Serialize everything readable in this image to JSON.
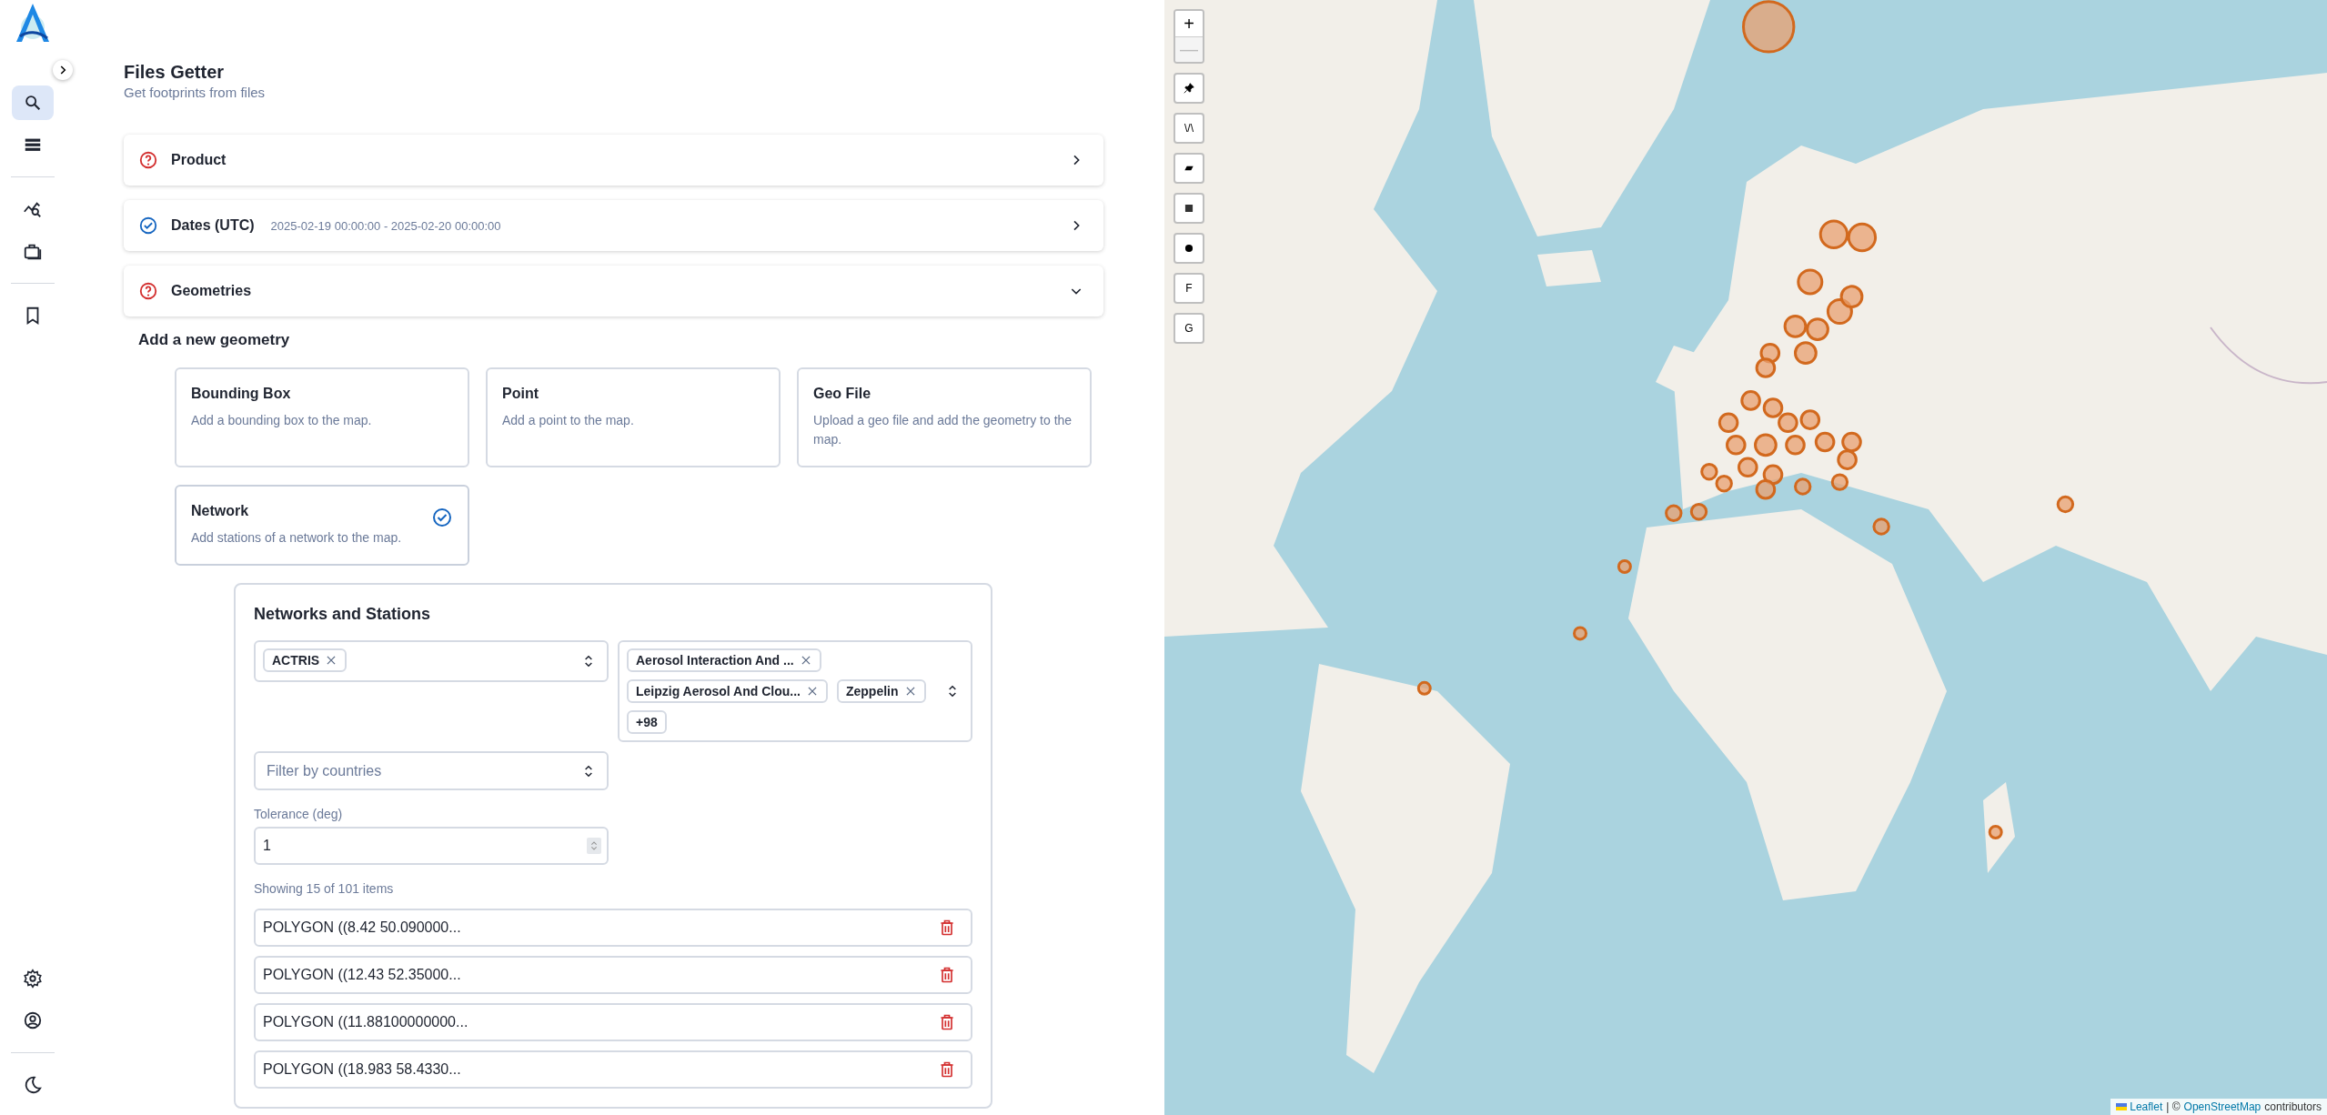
{
  "sidebar": {
    "items": [
      {
        "kind": "search",
        "selected": true
      },
      {
        "kind": "list",
        "selected": false
      },
      {
        "kind": "divider"
      },
      {
        "kind": "chart-search",
        "selected": false
      },
      {
        "kind": "briefcase",
        "selected": false
      },
      {
        "kind": "divider"
      },
      {
        "kind": "bookmark",
        "selected": false
      }
    ],
    "bottom_items": [
      {
        "kind": "settings",
        "selected": false
      },
      {
        "kind": "account",
        "selected": false
      },
      {
        "kind": "divider"
      },
      {
        "kind": "theme",
        "selected": false
      }
    ]
  },
  "page": {
    "title": "Files Getter",
    "subtitle": "Get footprints from files"
  },
  "sections": [
    {
      "label": "Product",
      "complete": false,
      "expanded": false
    },
    {
      "label": "Dates (UTC)",
      "complete": true,
      "summary": "2025-02-19 00:00:00 - 2025-02-20 00:00:00",
      "expanded": false
    },
    {
      "label": "Geometries",
      "complete": false,
      "expanded": true
    }
  ],
  "add_geometry": {
    "heading": "Add a new geometry",
    "options": [
      {
        "title": "Bounding Box",
        "description": "Add a bounding box to the map.",
        "selected": false
      },
      {
        "title": "Point",
        "description": "Add a point to the map.",
        "selected": false
      },
      {
        "title": "Geo File",
        "description": "Upload a geo file and add the geometry to the map.",
        "selected": false
      },
      {
        "title": "Network",
        "description": "Add stations of a network to the map.",
        "selected": true
      }
    ]
  },
  "networks_panel": {
    "title": "Networks and Stations",
    "network_select": {
      "chips": [
        "ACTRIS"
      ]
    },
    "station_select": {
      "chips": [
        "Aerosol Interaction And ...",
        "Leipzig Aerosol And Clou...",
        "Zeppelin"
      ],
      "more": "+98"
    },
    "country_filter": {
      "placeholder": "Filter by countries"
    },
    "tolerance": {
      "label": "Tolerance (deg)",
      "value": "1"
    },
    "count_text": "Showing 15 of 101 items",
    "geometries": [
      "POLYGON ((8.42 50.090000...",
      "POLYGON ((12.43 52.35000...",
      "POLYGON ((11.88100000000...",
      "POLYGON ((18.983 58.4330..."
    ]
  },
  "map": {
    "kind": "picture",
    "controls": [
      {
        "kind": "zoom-in",
        "label": "+",
        "disabled": false
      },
      {
        "kind": "zoom-out",
        "label": "—",
        "disabled": true
      },
      {
        "kind": "marker"
      },
      {
        "kind": "polyline",
        "label": "\\/\\"
      },
      {
        "kind": "polygon"
      },
      {
        "kind": "rectangle"
      },
      {
        "kind": "circle"
      },
      {
        "kind": "text",
        "label": "F"
      },
      {
        "kind": "text",
        "label": "G"
      }
    ],
    "attribution": {
      "library": "Leaflet",
      "separator": "| ©",
      "source": "OpenStreetMap",
      "suffix": "contributors"
    }
  }
}
